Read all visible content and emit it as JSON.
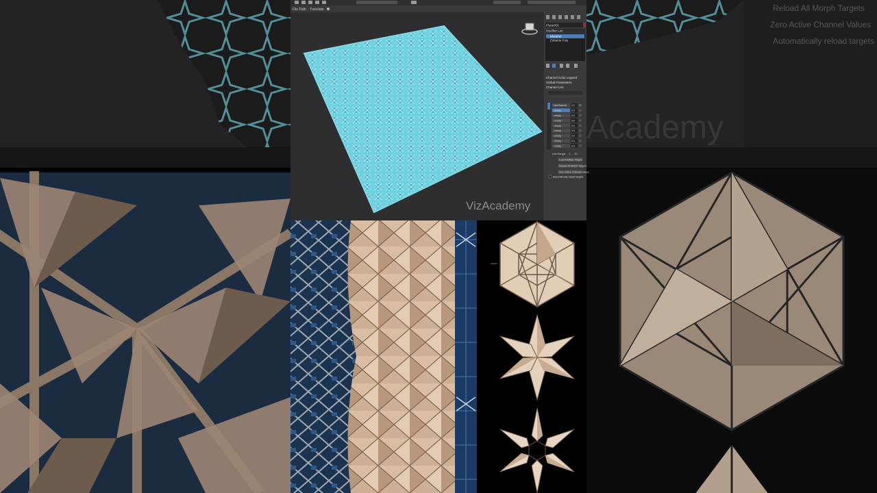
{
  "viewport": {
    "watermark": "VizAcademy",
    "mesh_color": "#7fd9e6",
    "background_color": "#2e2e30"
  },
  "toolbar": {
    "items": [
      "File Path",
      "Translate"
    ]
  },
  "right_panel": {
    "object_name": "Plane001",
    "modifier_list_label": "Modifier List",
    "stack": [
      "Morpher",
      "Editable Poly"
    ],
    "rollouts": [
      "Channel Color Legend",
      "Global Parameters",
      "Channel List"
    ],
    "channels": [
      {
        "name": "CapChannel",
        "value": "0.0"
      },
      {
        "name": "- empty -",
        "value": "0.0"
      },
      {
        "name": "- empty -",
        "value": "0.0"
      },
      {
        "name": "- empty -",
        "value": "0.0"
      },
      {
        "name": "- empty -",
        "value": "0.0"
      },
      {
        "name": "- empty -",
        "value": "0.0"
      },
      {
        "name": "- empty -",
        "value": "0.0"
      },
      {
        "name": "- empty -",
        "value": "0.0"
      },
      {
        "name": "- empty -",
        "value": "0.0"
      }
    ],
    "list_range_label": "List Range:",
    "list_range_from": "1",
    "list_range_to": "10",
    "buttons": [
      "Load Multiple Targets",
      "Reload All Morph Targets",
      "Zero Active Channel Values"
    ],
    "checkbox_label": "Automatically reload targets"
  },
  "background_overlay": {
    "lines": [
      "Reload All Morph Targets",
      "Zero Active Channel Values",
      "Automatically reload targets"
    ],
    "watermark": "Academy"
  },
  "colors": {
    "panel_bg": "#3a3a3c",
    "panel_dark": "#242426",
    "accent_blue": "#4a7fb5",
    "facade_beige": "#d8b89a",
    "glass_blue": "#1d3550"
  }
}
